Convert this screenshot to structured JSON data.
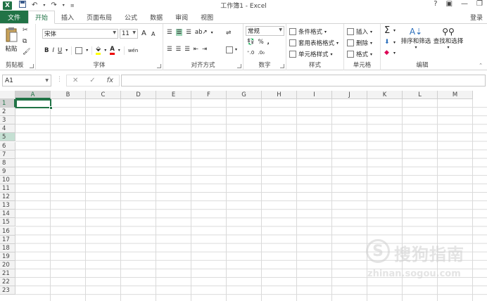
{
  "window": {
    "title": "工作簿1 - Excel",
    "app_badge": "X"
  },
  "qat": {
    "save_icon": "save-icon",
    "undo_icon": "undo-icon",
    "redo_icon": "redo-icon"
  },
  "window_controls": [
    "?",
    "▣",
    "—",
    "❐"
  ],
  "tabs": [
    {
      "label": "文件"
    },
    {
      "label": "开始"
    },
    {
      "label": "插入"
    },
    {
      "label": "页面布局"
    },
    {
      "label": "公式"
    },
    {
      "label": "数据"
    },
    {
      "label": "审阅"
    },
    {
      "label": "视图"
    }
  ],
  "login": "登录",
  "ribbon": {
    "clipboard": {
      "label": "剪贴板",
      "paste": "粘贴"
    },
    "font": {
      "label": "字体",
      "font_name": "宋体",
      "font_size": "11",
      "grow": "A",
      "shrink": "A",
      "bold": "B",
      "italic": "I",
      "underline": "U",
      "wen": "wén"
    },
    "alignment": {
      "label": "对齐方式"
    },
    "number": {
      "label": "数字",
      "format": "常规",
      "percent": "%",
      "comma": ","
    },
    "styles": {
      "label": "样式",
      "conditional": "条件格式",
      "table": "套用表格格式",
      "cell_styles": "单元格样式"
    },
    "cells": {
      "label": "单元格",
      "insert": "插入",
      "delete": "删除",
      "format": "格式"
    },
    "editing": {
      "label": "编辑",
      "sort": "排序和筛选",
      "find": "查找和选择",
      "sigma": "Σ"
    }
  },
  "formula_bar": {
    "name_box": "A1",
    "cancel": "✕",
    "enter": "✓",
    "fx": "fx",
    "value": ""
  },
  "columns": [
    "A",
    "B",
    "C",
    "D",
    "E",
    "F",
    "G",
    "H",
    "I",
    "J",
    "K",
    "L",
    "M"
  ],
  "rows": [
    "1",
    "2",
    "3",
    "4",
    "5",
    "6",
    "7",
    "8",
    "9",
    "10",
    "11",
    "12",
    "13",
    "14",
    "15",
    "16",
    "17",
    "18",
    "19",
    "20",
    "21",
    "22",
    "23"
  ],
  "selection": {
    "active_cell": "A1",
    "selected_column": "A",
    "highlighted_row": "5"
  },
  "watermark": {
    "mark": "S",
    "text": "搜狗指南",
    "url": "zhinan.sogou.com"
  },
  "colors": {
    "accent": "#217346"
  }
}
